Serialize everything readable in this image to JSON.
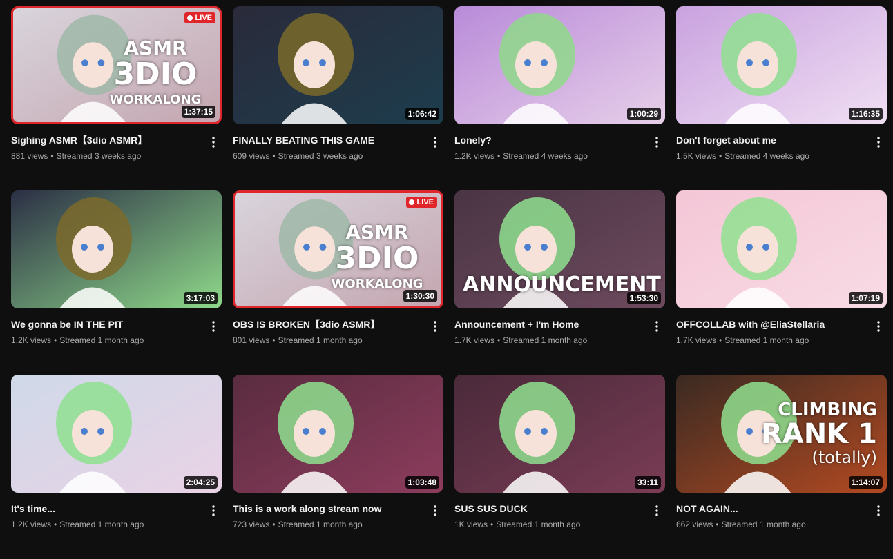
{
  "videos": [
    {
      "title": "Sighing ASMR【3dio ASMR】",
      "views": "881 views",
      "streamed": "Streamed 3 weeks ago",
      "duration": "1:37:15",
      "live": "LIVE",
      "overlay": [
        "ASMR",
        "3DIO",
        "WORKALONG"
      ],
      "colors": [
        "#d9d4dc",
        "#9fb8a8",
        "#c4a6b0"
      ]
    },
    {
      "title": "FINALLY BEATING THIS GAME",
      "views": "609 views",
      "streamed": "Streamed 3 weeks ago",
      "duration": "1:06:42",
      "live": "",
      "overlay": [],
      "colors": [
        "#2a2a3a",
        "#7a6a2a",
        "#1d3d4d"
      ]
    },
    {
      "title": "Lonely?",
      "views": "1.2K views",
      "streamed": "Streamed 4 weeks ago",
      "duration": "1:00:29",
      "live": "",
      "overlay": [],
      "colors": [
        "#b98bd9",
        "#8fd98a",
        "#e7cfe9"
      ]
    },
    {
      "title": "Don't forget about me",
      "views": "1.5K views",
      "streamed": "Streamed 4 weeks ago",
      "duration": "1:16:35",
      "live": "",
      "overlay": [],
      "colors": [
        "#c9a2df",
        "#8fe08f",
        "#f0dff3"
      ]
    },
    {
      "title": "We gonna be IN THE PIT",
      "views": "1.2K views",
      "streamed": "Streamed 1 month ago",
      "duration": "3:17:03",
      "live": "",
      "overlay": [],
      "colors": [
        "#2b2f45",
        "#7c6a2c",
        "#8fd98a"
      ]
    },
    {
      "title": "OBS IS BROKEN【3dio ASMR】",
      "views": "801 views",
      "streamed": "Streamed 1 month ago",
      "duration": "1:30:30",
      "live": "LIVE",
      "overlay": [
        "ASMR",
        "3DIO",
        "WORKALONG"
      ],
      "colors": [
        "#d9d4dc",
        "#9fb8a8",
        "#c4a6b0"
      ]
    },
    {
      "title": "Announcement + I'm Home",
      "views": "1.7K views",
      "streamed": "Streamed 1 month ago",
      "duration": "1:53:30",
      "live": "",
      "overlay": [
        "ANNOUNCEMENT"
      ],
      "colors": [
        "#4a3545",
        "#8fe08f",
        "#6d4a5d"
      ]
    },
    {
      "title": "OFFCOLLAB with @EliaStellaria",
      "views": "1.7K views",
      "streamed": "Streamed 1 month ago",
      "duration": "1:07:19",
      "live": "",
      "overlay": [],
      "colors": [
        "#f4c6d6",
        "#8fe08f",
        "#f8dbe5"
      ]
    },
    {
      "title": "It's time...",
      "views": "1.2K views",
      "streamed": "Streamed 1 month ago",
      "duration": "2:04:25",
      "live": "",
      "overlay": [],
      "colors": [
        "#cfd9e8",
        "#8fe08f",
        "#e9d2e6"
      ]
    },
    {
      "title": "This is a work along stream now",
      "views": "723 views",
      "streamed": "Streamed 1 month ago",
      "duration": "1:03:48",
      "live": "",
      "overlay": [],
      "colors": [
        "#5a2c40",
        "#8fe08f",
        "#8c3c5c"
      ]
    },
    {
      "title": "SUS SUS DUCK",
      "views": "1K views",
      "streamed": "Streamed 1 month ago",
      "duration": "33:11",
      "live": "",
      "overlay": [],
      "colors": [
        "#4a2a3a",
        "#8fe08f",
        "#7a3c55"
      ]
    },
    {
      "title": "NOT AGAIN...",
      "views": "662 views",
      "streamed": "Streamed 1 month ago",
      "duration": "1:14:07",
      "live": "",
      "overlay": [
        "CLIMBING",
        "RANK 1",
        "(totally)"
      ],
      "colors": [
        "#3a2a22",
        "#8fe08f",
        "#b34a22"
      ]
    }
  ],
  "separator": "•",
  "more_icon": "kebab-menu-icon",
  "accent_live": "#e0262b"
}
